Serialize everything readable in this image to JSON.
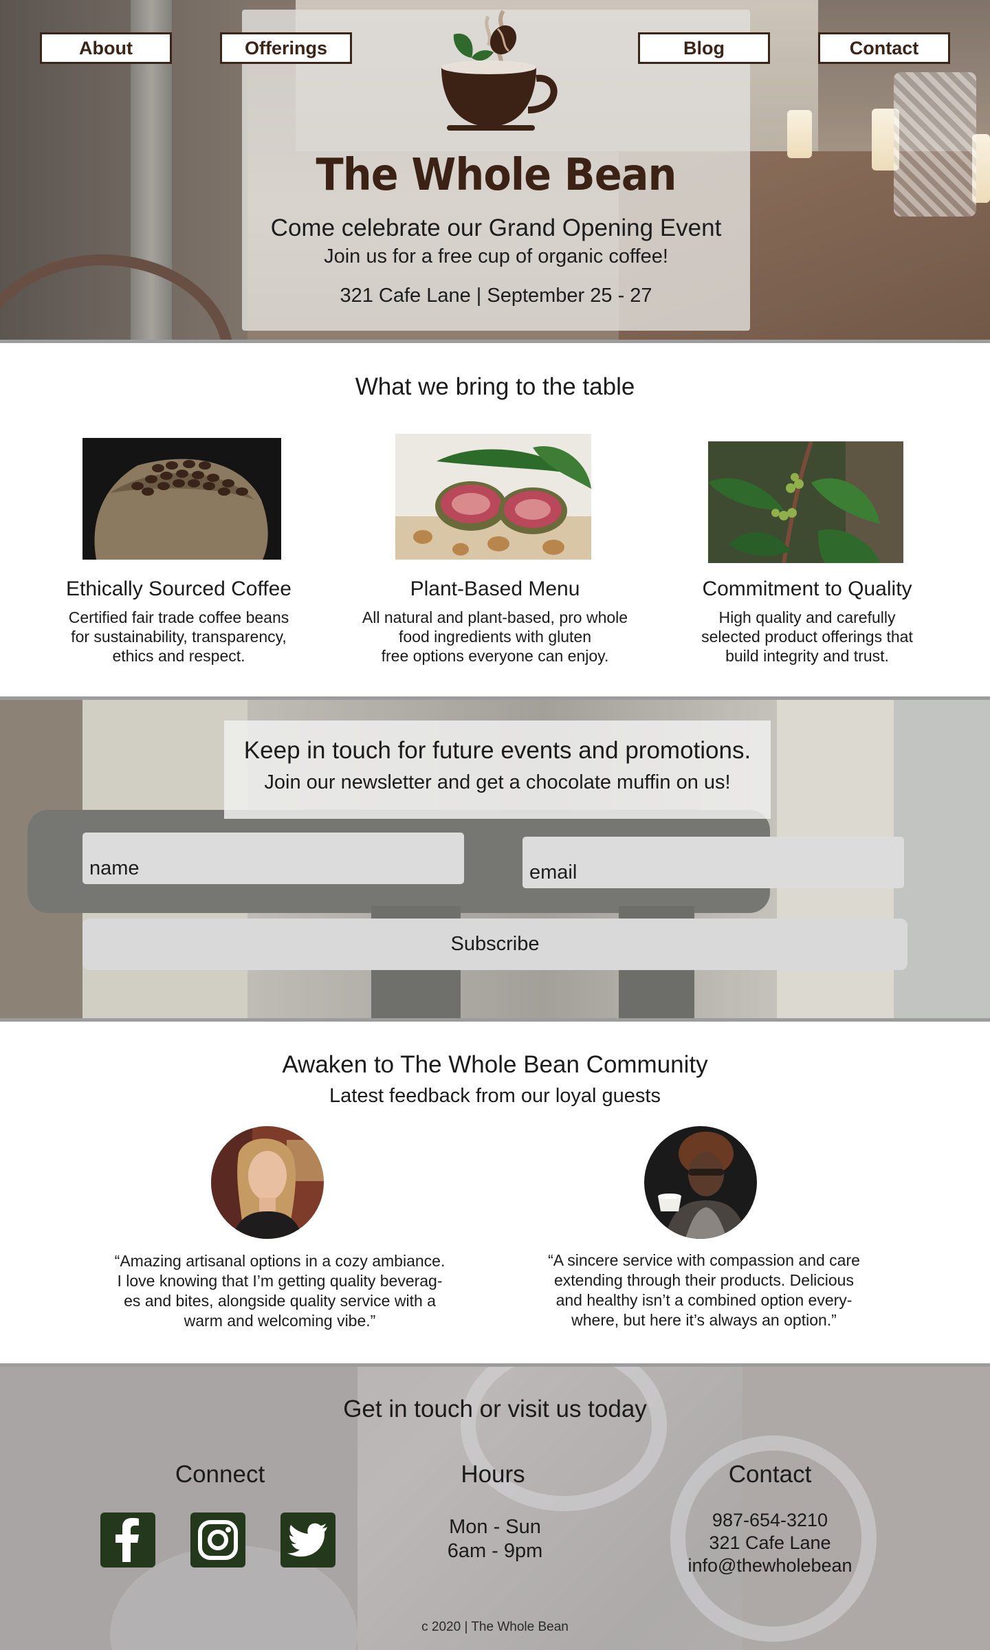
{
  "colors": {
    "brand_brown": "#3b2418",
    "social_green": "#24391c",
    "field_gray": "#dcdcdc"
  },
  "nav": {
    "items": [
      {
        "label": "About",
        "icon": null
      },
      {
        "label": "Offerings",
        "icon": null
      },
      {
        "label": "Blog",
        "icon": null
      },
      {
        "label": "Contact",
        "icon": null
      }
    ]
  },
  "hero": {
    "brand": "The Whole Bean",
    "headline": "Come celebrate our Grand Opening Event",
    "subline": "Join us for a free cup of organic coffee!",
    "details": "321 Cafe Lane | September 25 - 27",
    "logo_icon": "coffee-cup-logo"
  },
  "features": {
    "title": "What we bring to the table",
    "items": [
      {
        "title": "Ethically Sourced Coffee",
        "desc": "Certified fair trade coffee beans\nfor sustainability, transparency,\nethics and respect.",
        "image": "coffee-beans-sack"
      },
      {
        "title": "Plant-Based Menu",
        "desc": "All natural and plant-based, pro whole\nfood ingredients with gluten\nfree options everyone can enjoy.",
        "image": "figs-and-walnuts"
      },
      {
        "title": "Commitment to Quality",
        "desc": "High quality and carefully\nselected product offerings that\nbuild integrity and trust.",
        "image": "coffee-plant"
      }
    ]
  },
  "newsletter": {
    "heading": "Keep in touch for future events and promotions.",
    "subheading": "Join our newsletter and get a chocolate muffin on us!",
    "name_placeholder": "name",
    "email_placeholder": "email",
    "button": "Subscribe"
  },
  "community": {
    "title": "Awaken to The Whole Bean Community",
    "subtitle": "Latest feedback from our loyal guests",
    "testimonials": [
      {
        "quote": "“Amazing artisanal options in a cozy ambiance.\nI love knowing that I’m getting quality beverag-\nes and bites, alongside quality service with a\nwarm and welcoming vibe.”"
      },
      {
        "quote": "“A sincere service with compassion and care\nextending through their products. Delicious\nand healthy isn’t a combined option every-\nwhere, but here it’s always an option.”"
      }
    ]
  },
  "footer": {
    "title": "Get in touch or visit us today",
    "connect_title": "Connect",
    "hours_title": "Hours",
    "hours_text": "Mon - Sun\n6am - 9pm",
    "contact_title": "Contact",
    "contact_text": "987-654-3210\n321 Cafe Lane\ninfo@thewholebean",
    "social_icons": [
      "facebook-icon",
      "instagram-icon",
      "twitter-icon"
    ],
    "copyright": "c 2020 | The Whole Bean"
  }
}
